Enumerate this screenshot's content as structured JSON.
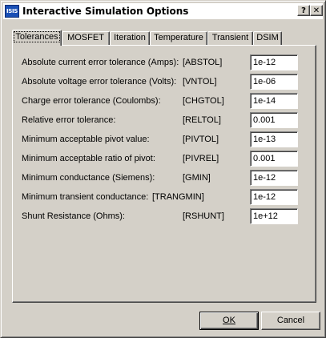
{
  "window": {
    "icon_text": "ISIS",
    "title": "Interactive Simulation Options",
    "help_button": "?",
    "close_button": "✕"
  },
  "tabs": [
    {
      "label": "Tolerances",
      "active": true
    },
    {
      "label": "MOSFET",
      "active": false
    },
    {
      "label": "Iteration",
      "active": false
    },
    {
      "label": "Temperature",
      "active": false
    },
    {
      "label": "Transient",
      "active": false
    },
    {
      "label": "DSIM",
      "active": false
    }
  ],
  "parameters": [
    {
      "label": "Absolute current error tolerance (Amps):",
      "code": "[ABSTOL]",
      "value": "1e-12"
    },
    {
      "label": "Absolute voltage error tolerance (Volts):",
      "code": "[VNTOL]",
      "value": "1e-06"
    },
    {
      "label": "Charge error tolerance (Coulombs):",
      "code": "[CHGTOL]",
      "value": "1e-14"
    },
    {
      "label": "Relative error tolerance:",
      "code": "[RELTOL]",
      "value": "0.001"
    },
    {
      "label": "Minimum acceptable pivot value:",
      "code": "[PIVTOL]",
      "value": "1e-13"
    },
    {
      "label": "Minimum acceptable ratio of pivot:",
      "code": "[PIVREL]",
      "value": "0.001"
    },
    {
      "label": "Minimum conductance (Siemens):",
      "code": "[GMIN]",
      "value": "1e-12"
    },
    {
      "label": "Minimum transient conductance:",
      "code": "[TRANGMIN]",
      "value": "1e-12"
    },
    {
      "label": "Shunt Resistance (Ohms):",
      "code": "[RSHUNT]",
      "value": "1e+12"
    }
  ],
  "buttons": {
    "ok_label": "OK",
    "cancel_label": "Cancel"
  }
}
